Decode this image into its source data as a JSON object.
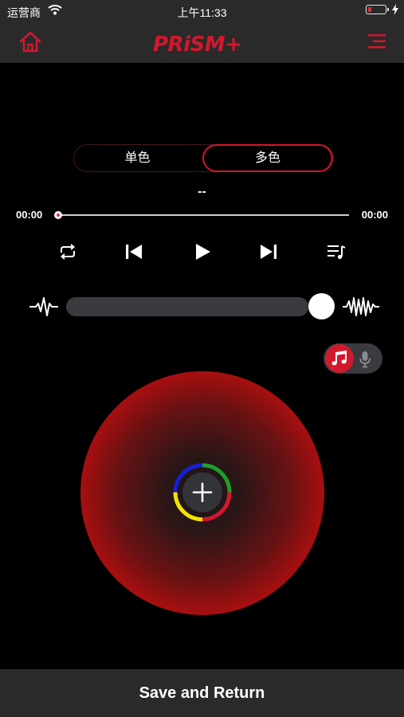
{
  "status_bar": {
    "carrier": "运营商",
    "time": "上午11:33",
    "battery_fraction": 0.15,
    "icons": [
      "wifi-icon",
      "battery-icon",
      "charging-bolt-icon"
    ]
  },
  "nav": {
    "home_icon": "home-icon",
    "logo_text": "PRiSM+",
    "menu_icon": "hamburger-menu-icon"
  },
  "mode_tabs": {
    "single": "单色",
    "multi": "多色",
    "selected": "multi"
  },
  "player": {
    "track_title": "--",
    "elapsed": "00:00",
    "duration": "00:00",
    "progress_fraction": 0,
    "controls": [
      "repeat-icon",
      "previous-icon",
      "play-icon",
      "next-icon",
      "playlist-icon"
    ]
  },
  "sensitivity": {
    "low_icon": "low-wave-icon",
    "high_icon": "high-wave-icon",
    "level_fraction": 1.0
  },
  "audio_source": {
    "options": [
      "music-note-icon",
      "microphone-icon"
    ],
    "selected": "music"
  },
  "color_wheel": {
    "center_color": "#1a1416",
    "edge_color": "#ff0a0a",
    "ring_colors": [
      "#1f9e2a",
      "#d2182d",
      "#f2e400",
      "#1520d8"
    ],
    "add_icon": "plus-icon"
  },
  "colors": {
    "accent": "#d2182d",
    "background": "#000000",
    "bar": "#2a2a2b"
  },
  "footer": {
    "save_label": "Save and Return"
  }
}
